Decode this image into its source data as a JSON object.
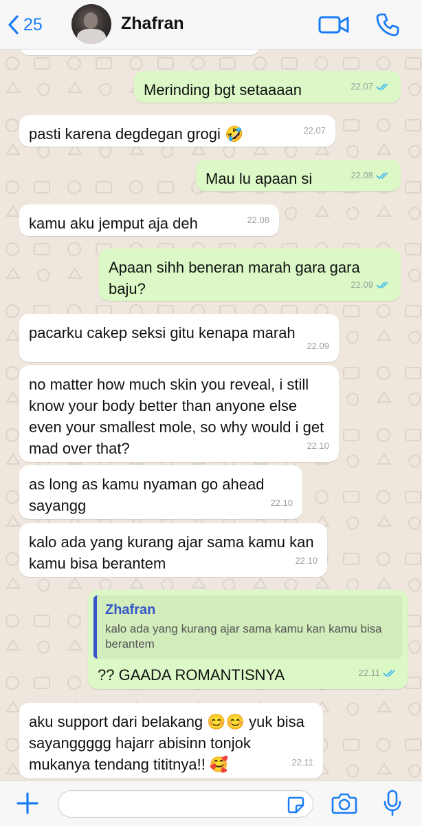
{
  "header": {
    "back_count": "25",
    "contact_name": "Zhafran"
  },
  "messages": [
    {
      "dir": "out",
      "text": "Merinding bgt setaaaan",
      "time": "22.07"
    },
    {
      "dir": "in",
      "text": "pasti karena degdegan grogi 🤣",
      "time": "22.07"
    },
    {
      "dir": "out",
      "text": "Mau lu apaan si",
      "time": "22.08"
    },
    {
      "dir": "in",
      "text": "kamu aku jemput aja deh",
      "time": "22.08"
    },
    {
      "dir": "out",
      "text": "Apaan sihh beneran marah gara gara baju?",
      "time": "22.09"
    },
    {
      "dir": "in",
      "text": "pacarku cakep seksi gitu kenapa marah",
      "time": "22.09"
    },
    {
      "dir": "in",
      "text": "no matter how much skin you reveal, i still know your body better than anyone else even your smallest mole, so why would i get mad over that?",
      "time": "22.10"
    },
    {
      "dir": "in",
      "text": "as long as kamu nyaman go ahead sayangg",
      "time": "22.10"
    },
    {
      "dir": "in",
      "text": "kalo ada yang kurang ajar sama kamu kan kamu bisa berantem",
      "time": "22.10"
    },
    {
      "dir": "out",
      "quote_name": "Zhafran",
      "quote_text": "kalo ada yang kurang ajar sama kamu kan kamu bisa berantem",
      "text": "?? GAADA ROMANTISNYA",
      "time": "22.11"
    },
    {
      "dir": "in",
      "text": "aku support dari belakang 😊😊 yuk bisa sayanggggg hajarr abisinn tonjok mukanya tendang tititnya!! 🥰",
      "time": "22.11"
    }
  ],
  "colors": {
    "accent": "#1a7cf5",
    "outgoing_bubble": "#dcf8c6",
    "incoming_bubble": "#ffffff",
    "read_ticks": "#34b7f1"
  },
  "icons": [
    "chevron-left-icon",
    "video-call-icon",
    "phone-icon",
    "plus-icon",
    "sticker-icon",
    "camera-icon",
    "microphone-icon",
    "double-check-icon"
  ]
}
